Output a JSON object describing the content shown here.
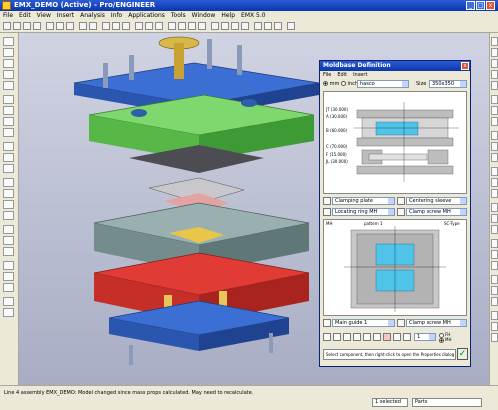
{
  "window": {
    "title": "EMX_DEMO (Active) - Pro/ENGINEER",
    "minimize": "_",
    "maximize": "□",
    "close": "x"
  },
  "menubar": [
    "File",
    "Edit",
    "View",
    "Insert",
    "Analysis",
    "Info",
    "Applications",
    "Tools",
    "Window",
    "Help",
    "EMX 5.0"
  ],
  "status": {
    "message": "Line 4 assembly EMX_DEMO: Model changed since mass props calculated. May need to recalculate.",
    "selected": "1 selected",
    "filter": "Parts"
  },
  "dialog": {
    "title": "Moldbase Definition",
    "menu": [
      "File",
      "Edit",
      "Insert"
    ],
    "units": {
      "mm": "mm",
      "inch": "inch",
      "selected": "mm"
    },
    "vendor": "hasco",
    "size_label": "Size",
    "size": "350x350",
    "plate_labels": [
      "JT (30.000)",
      "A (30.000)",
      "B (60.000)",
      "C (70.000)",
      "F (15.000)",
      "JL (30.000)"
    ],
    "components_top": [
      {
        "left": "Clamping plate",
        "right": "Centering sleeve"
      },
      {
        "left": "Locating ring MH",
        "right": "Clamp screw MH"
      }
    ],
    "plan_label_left": "MH",
    "plan_label_center": "pattern 1",
    "plan_label_right": "SC-Type",
    "components_bottom": [
      {
        "left": "Main guide 1",
        "right": "Clamp screw MH"
      }
    ],
    "count_value": "1",
    "fh_label": "FH",
    "mh_label": "MH",
    "hint": "Select component, then right-click to open the Properties dialog box",
    "ok": "✓"
  },
  "icons": [
    "app-icon",
    "new-icon",
    "open-icon",
    "save-icon",
    "print-icon",
    "zoom-icon",
    "refresh-icon",
    "check-icon"
  ]
}
